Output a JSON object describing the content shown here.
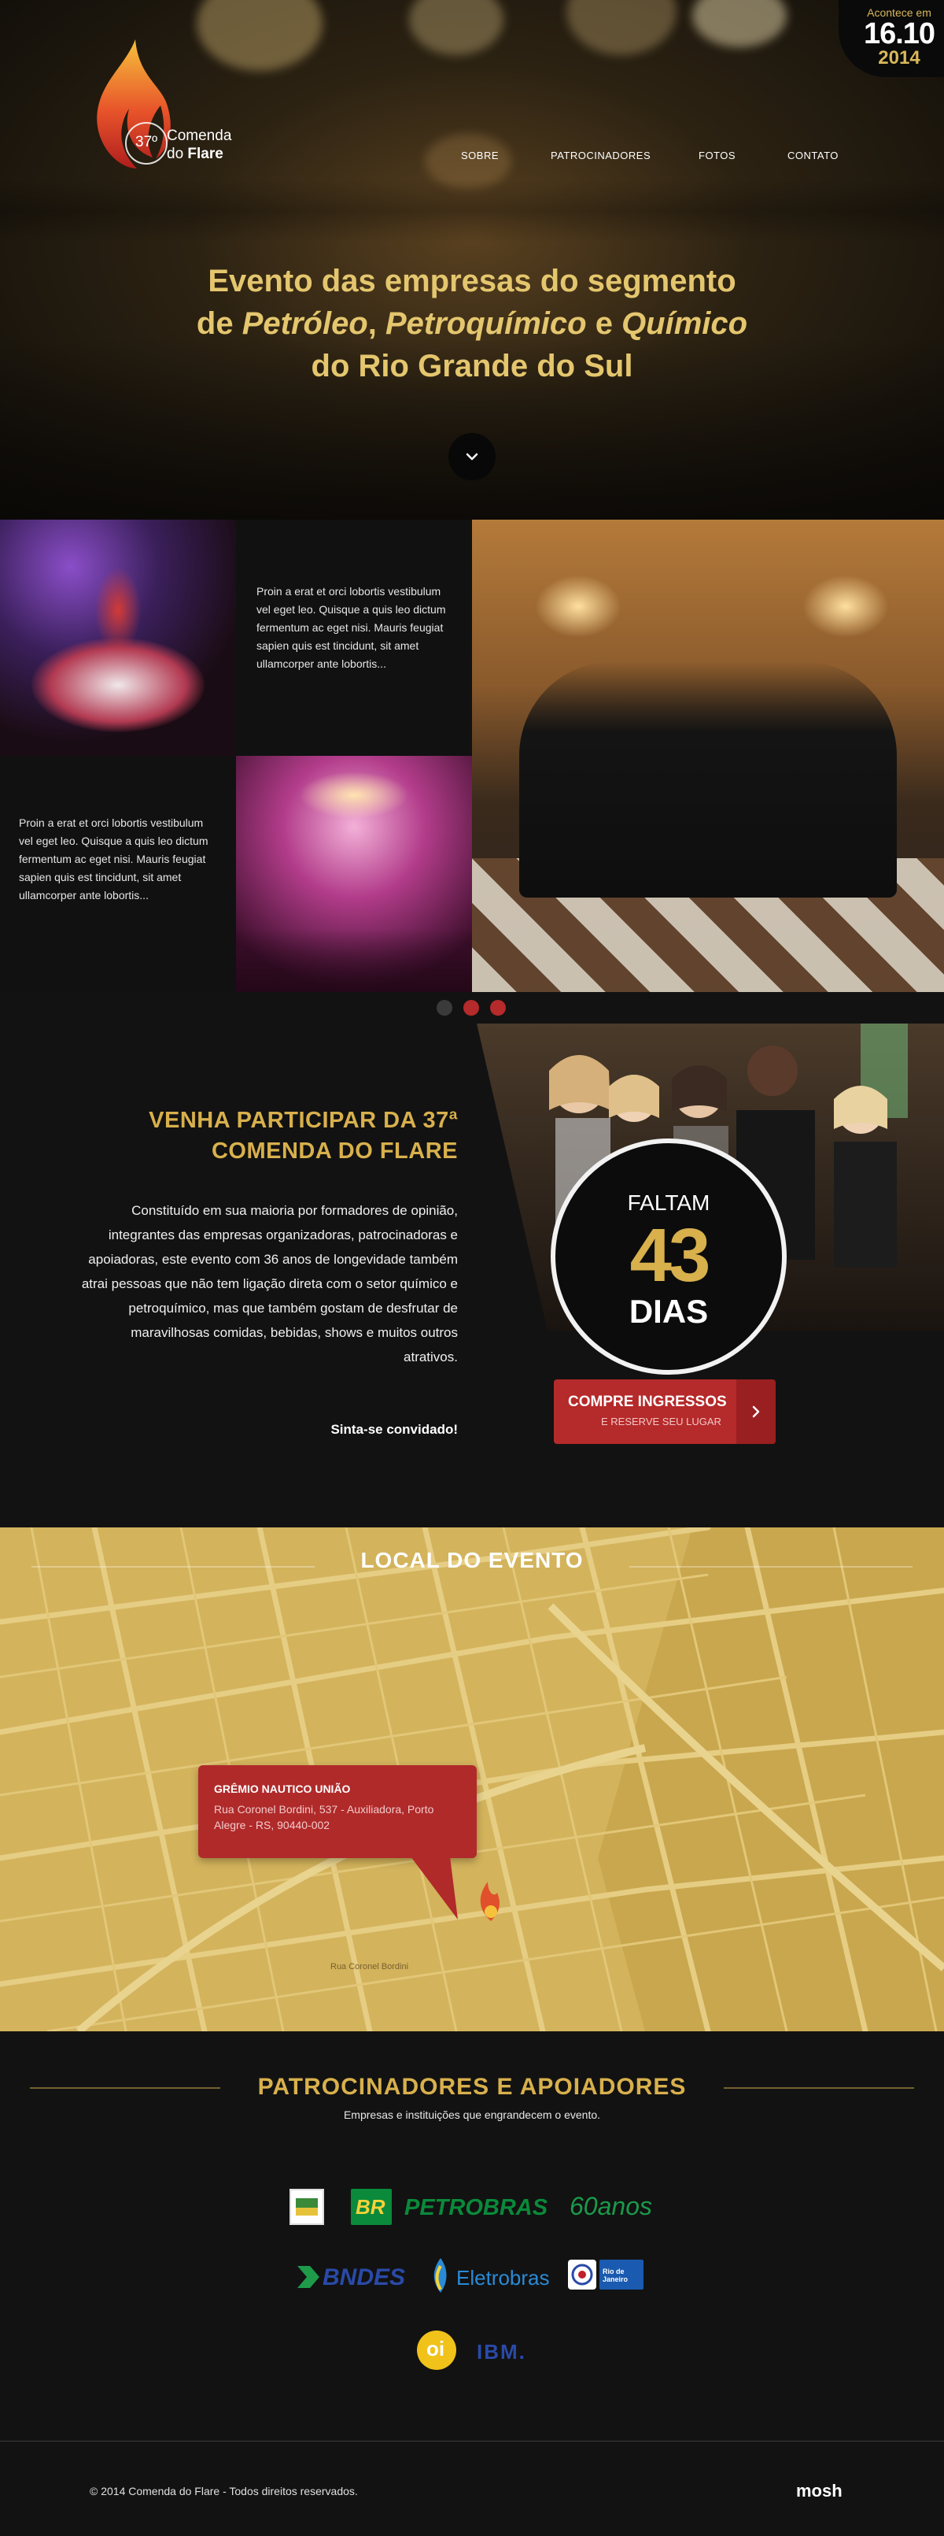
{
  "brand": {
    "edition": "37º",
    "name_line1": "Comenda",
    "name_line2_prefix": "do",
    "name_line2_bold": "Flare"
  },
  "nav": {
    "items": [
      "SOBRE",
      "PATROCINADORES",
      "FOTOS",
      "CONTATO"
    ]
  },
  "date_badge": {
    "label": "Acontece em",
    "date": "16.10",
    "year": "2014"
  },
  "hero": {
    "line1": "Evento das empresas do segmento",
    "line2_prefix": "de ",
    "word1": "Petróleo",
    "sep1": ", ",
    "word2": "Petroquímico",
    "sep2": " e ",
    "word3": "Químico",
    "line3": "do Rio Grande do Sul"
  },
  "gallery": {
    "text_tile_1": "Proin a erat et orci lobortis vestibulum vel eget leo. Quisque a quis leo dictum fermentum ac eget nisi. Mauris feugiat sapien quis est tincidunt, sit amet ullamcorper ante lobortis...",
    "text_tile_2": "Proin a erat et orci lobortis vestibulum vel eget leo. Quisque a quis leo dictum fermentum ac eget nisi. Mauris feugiat sapien quis est tincidunt, sit amet ullamcorper ante lobortis...",
    "dots_active_index": 1
  },
  "participate": {
    "title_line1": "VENHA PARTICIPAR DA 37ª",
    "title_line2": "COMENDA DO FLARE",
    "body": "Constituído em sua maioria por formadores de opinião, integrantes das empresas organizadoras, patrocinadoras e apoiadoras, este evento com 36 anos de longevidade também atrai pessoas que não tem ligação direta com o setor químico e petroquímico, mas que também gostam de desfrutar de maravilhosas comidas, bebidas, shows e muitos outros atrativos.",
    "cta": "Sinta-se convidado!"
  },
  "countdown": {
    "prefix": "FALTAM",
    "number": "43",
    "unit": "DIAS"
  },
  "ticket": {
    "label": "COMPRE INGRESSOS",
    "sub": "E RESERVE SEU LUGAR"
  },
  "location": {
    "title": "LOCAL DO EVENTO",
    "venue": "GRÊMIO NAUTICO UNIÃO",
    "address": "Rua Coronel Bordini, 537 - Auxiliadora, Porto Alegre - RS, 90440-002",
    "street_label": "Rua Coronel Bordini"
  },
  "sponsors": {
    "title": "PATROCINADORES E APOIADORES",
    "subtitle": "Empresas e instituições que engrandecem o evento.",
    "logos": {
      "br": "BR",
      "petrobras": "PETROBRAS",
      "anos": "60anos",
      "bndes": "BNDES",
      "eletrobras": "Eletrobras",
      "rio": "Rio de Janeiro",
      "oi": "oi",
      "ibm": "IBM."
    }
  },
  "footer": {
    "copyright": "© 2014 Comenda do Flare - Todos direitos reservados.",
    "credit": "mosh"
  },
  "colors": {
    "gold": "#d8b04c",
    "red": "#b52a2a",
    "dark": "#121212",
    "map": "#d3b35c"
  }
}
